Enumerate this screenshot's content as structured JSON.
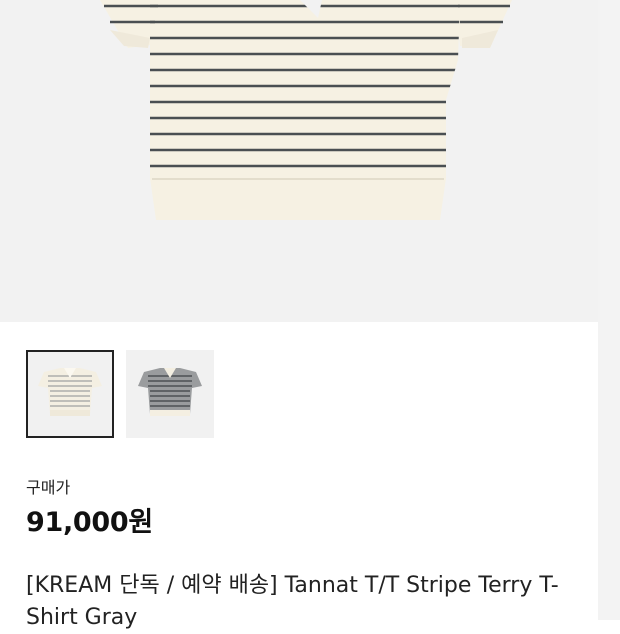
{
  "product": {
    "purchase_price_label": "구매가",
    "price": "91,000원",
    "title": "[KREAM 단독 / 예약 배송] Tannat T/T Stripe Terry T-Shirt Gray"
  },
  "gallery": {
    "selected_index": 0,
    "thumbnails": [
      "cream-stripe-shirt",
      "gray-stripe-shirt"
    ]
  },
  "colors": {
    "shirt_base": "#f6f1e3",
    "stripe": "#4a4f52",
    "thumb_stripe_dark": "#5a5d60"
  }
}
